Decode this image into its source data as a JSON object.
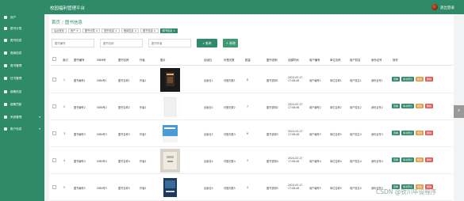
{
  "app": {
    "title": "校园福利管理平台",
    "logout": "退出登录"
  },
  "sidebar": {
    "items": [
      {
        "label": "后台首页"
      },
      {
        "label": "用户"
      },
      {
        "label": "图书分类"
      },
      {
        "label": "图书信息"
      },
      {
        "label": "借阅信息"
      },
      {
        "label": "借书管理"
      },
      {
        "label": "还书管理"
      },
      {
        "label": "超期信息"
      },
      {
        "label": "超期罚款"
      },
      {
        "label": "系统管理",
        "arrow": "▾"
      },
      {
        "label": "账户信息",
        "arrow": "▾"
      }
    ]
  },
  "breadcrumb": {
    "home": "首页",
    "sep": "/",
    "current": "图书信息"
  },
  "tabs": [
    {
      "label": "后台首页"
    },
    {
      "label": "用户 ×"
    },
    {
      "label": "图书分类 ×"
    },
    {
      "label": "图书信息 ×"
    },
    {
      "label": "借阅信息 ×"
    },
    {
      "label": "图书信息 ×"
    },
    {
      "label": "图书信息 ×",
      "active": true
    }
  ],
  "search": {
    "p1": "图书编号",
    "p2": "图书名称",
    "p3": "图书作者",
    "search_label": "查询",
    "add_label": "新增"
  },
  "table": {
    "headers": [
      "索引",
      "图书编号",
      "ISBN号",
      "图书名称",
      "作者",
      "图片",
      "出版社",
      "可借天数",
      "数量",
      "图书说明",
      "创建时间",
      "用户编号",
      "单位名称",
      "用户姓名",
      "身份证号",
      "操作"
    ],
    "rows": [
      {
        "idx": "1",
        "no": "图书编号1",
        "isbn": "ISBN号1",
        "name": "图书名称1",
        "author": "作者1",
        "press": "出版社1",
        "days": "可借天数1",
        "qty": "8",
        "desc": "图书说明1",
        "time": "2024-03-27 17:08:46",
        "uno": "用户编号1",
        "unit": "单位名称1",
        "uname": "用户姓名1",
        "idno": "身份证号1"
      },
      {
        "idx": "2",
        "no": "图书编号2",
        "isbn": "ISBN号2",
        "name": "图书名称2",
        "author": "作者2",
        "press": "出版社2",
        "days": "可借天数2",
        "qty": "7",
        "desc": "图书说明2",
        "time": "2024-03-27 17:08:46",
        "uno": "用户编号2",
        "unit": "单位名称2",
        "uname": "用户姓名2",
        "idno": "身份证号2"
      },
      {
        "idx": "3",
        "no": "图书编号3",
        "isbn": "ISBN号3",
        "name": "图书名称3",
        "author": "作者3",
        "press": "出版社3",
        "days": "可借天数3",
        "qty": "6",
        "desc": "图书说明3",
        "time": "2024-03-27 17:08:46",
        "uno": "用户编号3",
        "unit": "单位名称3",
        "uname": "用户姓名3",
        "idno": "身份证号3"
      },
      {
        "idx": "4",
        "no": "图书编号4",
        "isbn": "ISBN号4",
        "name": "图书名称4",
        "author": "作者4",
        "press": "出版社4",
        "days": "可借天数4",
        "qty": "3",
        "desc": "图书说明4",
        "time": "2024-03-27 17:08:46",
        "uno": "用户编号4",
        "unit": "单位名称4",
        "uname": "用户姓名4",
        "idno": "身份证号4"
      },
      {
        "idx": "5",
        "no": "图书编号5",
        "isbn": "ISBN号5",
        "name": "图书名称5",
        "author": "作者5",
        "press": "出版社5",
        "days": "可借天数5",
        "qty": "4",
        "desc": "图书说明5",
        "time": "2024-03-27 17:08:46",
        "uno": "用户编号5",
        "unit": "单位名称5",
        "uname": "用户姓名5",
        "idno": "身份证号5"
      }
    ],
    "ops": {
      "view": "查看",
      "borrow": "借书登记",
      "edit": "修改",
      "del": "删除"
    }
  },
  "colors": {
    "brand": "#2f8a6a",
    "edit": "#e3a04f",
    "delete": "#e35a5a"
  },
  "watermark": "CSDN @钦川毕设程序"
}
